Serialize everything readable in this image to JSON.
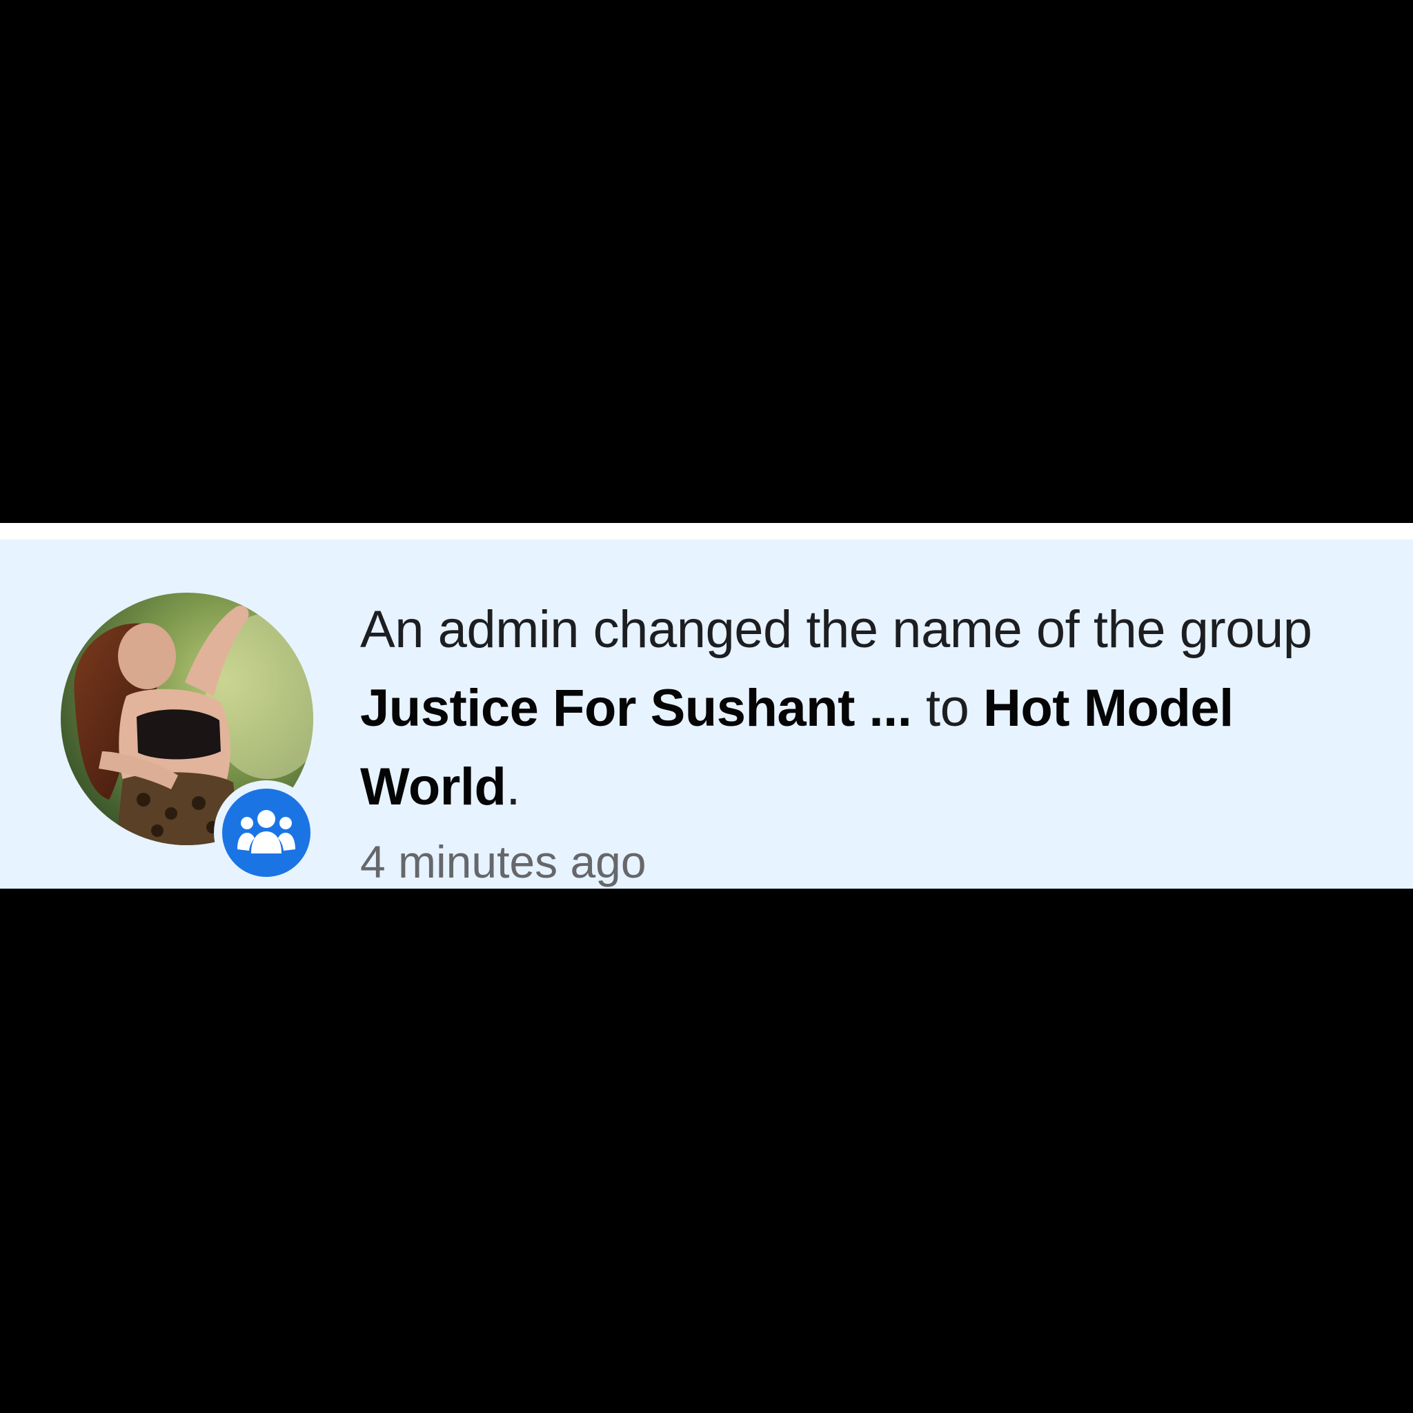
{
  "notification": {
    "message_prefix": "An admin changed the name of the group",
    "old_group_name": "Justice For Sushant ...",
    "connector": "to",
    "new_group_name": "Hot Model World",
    "message_suffix": ".",
    "timestamp": "4 minutes ago",
    "badge_icon": "group-icon",
    "badge_color": "#1b74e4",
    "background_color": "#e7f3ff"
  }
}
